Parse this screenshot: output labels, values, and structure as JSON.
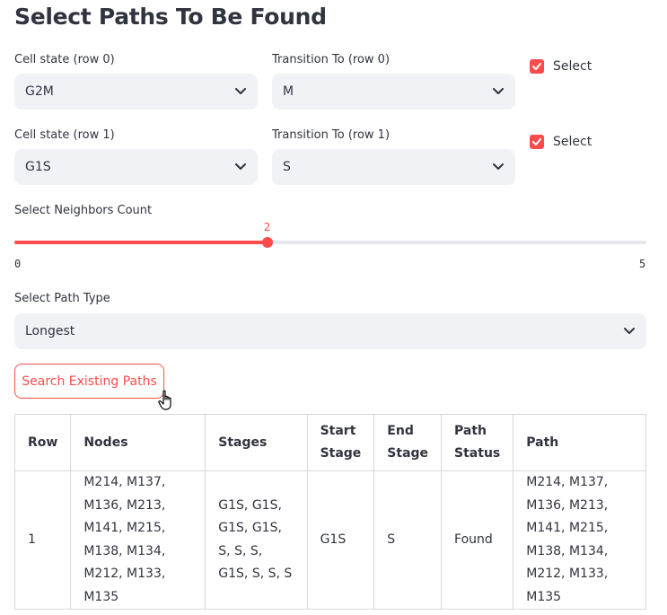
{
  "page": {
    "title": "Select Paths To Be Found"
  },
  "rows": [
    {
      "cell_state_label": "Cell state (row 0)",
      "cell_state_value": "G2M",
      "transition_label": "Transition To (row 0)",
      "transition_value": "M",
      "select_label": "Select",
      "checked": true
    },
    {
      "cell_state_label": "Cell state (row 1)",
      "cell_state_value": "G1S",
      "transition_label": "Transition To (row 1)",
      "transition_value": "S",
      "select_label": "Select",
      "checked": true
    }
  ],
  "neighbors": {
    "label": "Select Neighbors Count",
    "value": "2",
    "min": "0",
    "max": "5",
    "fraction": 0.4
  },
  "path_type": {
    "label": "Select Path Type",
    "value": "Longest"
  },
  "search_button": {
    "label": "Search Existing Paths"
  },
  "table": {
    "headers": [
      "Row",
      "Nodes",
      "Stages",
      "Start Stage",
      "End Stage",
      "Path Status",
      "Path"
    ],
    "rows": [
      [
        "1",
        "M214, M137, M136, M213, M141, M215, M138, M134, M212, M133, M135",
        "G1S, G1S, G1S, G1S, S, S, S, G1S, S, S, S",
        "G1S",
        "S",
        "Found",
        "M214, M137, M136, M213, M141, M215, M138, M134, M212, M133, M135"
      ]
    ]
  },
  "colors": {
    "accent": "#ff4b4b",
    "select_bg": "#f0f2f6",
    "text": "#31333f"
  }
}
